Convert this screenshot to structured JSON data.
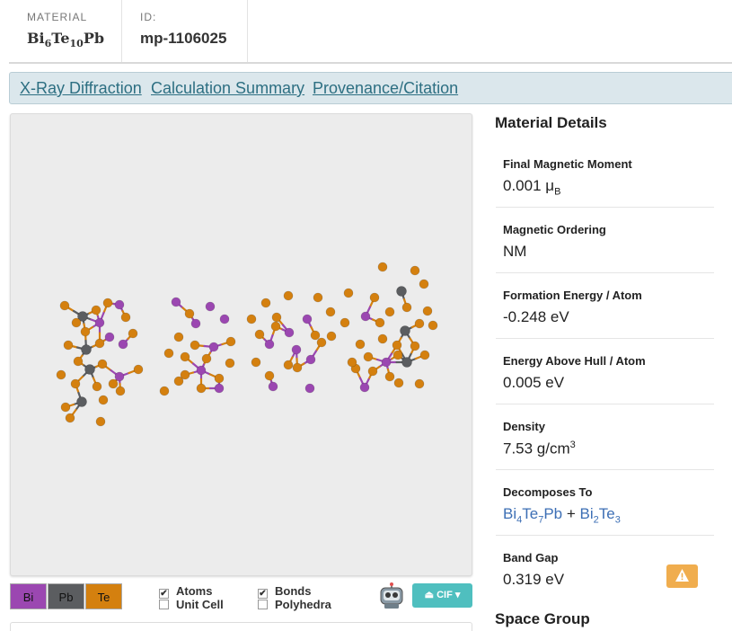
{
  "header": {
    "material_label": "MATERIAL",
    "formula": {
      "p1": "Bi",
      "s1": "6",
      "p2": "Te",
      "s2": "10",
      "p3": "Pb"
    },
    "id_label": "ID:",
    "id_value": "mp-1106025"
  },
  "tabs": [
    "X-Ray Diffraction",
    "Calculation Summary",
    "Provenance/Citation"
  ],
  "viewer": {
    "legend": [
      {
        "label": "Bi",
        "color": "#9b47b1"
      },
      {
        "label": "Pb",
        "color": "#5b5d60"
      },
      {
        "label": "Te",
        "color": "#d4800f"
      }
    ],
    "options": [
      {
        "label": "Atoms",
        "checked": true
      },
      {
        "label": "Unit Cell",
        "checked": false
      },
      {
        "label": "Bonds",
        "checked": true
      },
      {
        "label": "Polyhedra",
        "checked": false
      }
    ],
    "robot_icon": "robot-icon",
    "cif_label": "CIF"
  },
  "details": {
    "title": "Material Details",
    "rows": [
      {
        "label": "Final Magnetic Moment",
        "value": "0.001 μ",
        "sub": "B"
      },
      {
        "label": "Magnetic Ordering",
        "value": "NM"
      },
      {
        "label": "Formation Energy / Atom",
        "value": "-0.248 eV"
      },
      {
        "label": "Energy Above Hull / Atom",
        "value": "0.005 eV"
      },
      {
        "label": "Density",
        "value": "7.53 g/cm",
        "sup": "3"
      },
      {
        "label": "Decomposes To",
        "link1": {
          "p1": "Bi",
          "s1": "4",
          "p2": "Te",
          "s2": "7",
          "p3": "Pb"
        },
        "plus": "+",
        "link2": {
          "p1": "Bi",
          "s1": "2",
          "p2": "Te",
          "s2": "3"
        }
      },
      {
        "label": "Band Gap",
        "value": "0.319 eV",
        "warn_icon": "warning-icon"
      }
    ],
    "next_section": "Space Group"
  }
}
